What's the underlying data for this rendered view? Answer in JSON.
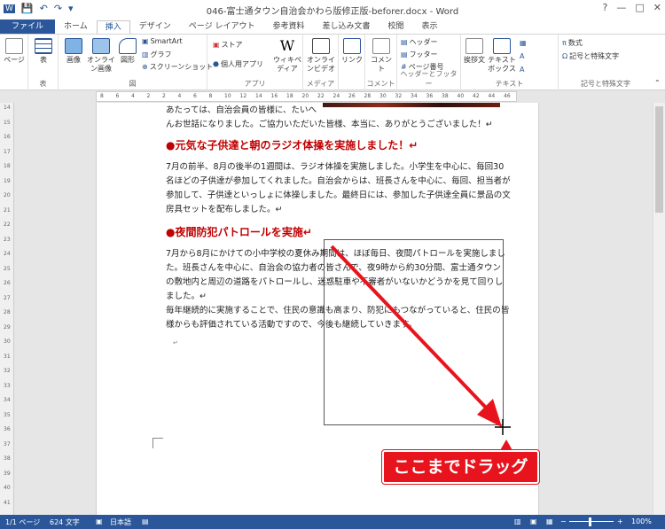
{
  "window": {
    "title": "046-富士通タウン自治会かわら版修正版-beforer.docx - Word",
    "controls": [
      "?",
      "—",
      "□",
      "✕"
    ]
  },
  "tabs": [
    "ファイル",
    "ホーム",
    "挿入",
    "デザイン",
    "ページ レイアウト",
    "参考資料",
    "差し込み文書",
    "校閲",
    "表示"
  ],
  "ribbon": {
    "page_btn": "ページ",
    "table_btn": "表",
    "table_group": "表",
    "picture_btn": "画像",
    "online_picture_btn": "オンライン画像",
    "shapes_btn": "図形",
    "smartart": "SmartArt",
    "graph": "グラフ",
    "screenshot": "スクリーンショット",
    "illustrations_group": "図",
    "store": "ストア",
    "personal_apps": "個人用アプリ",
    "wikipedia": "ウィキペディア",
    "apps_group": "アプリ",
    "online_video": "オンラインビデオ",
    "media_group": "メディア",
    "link_btn": "リンク",
    "comment_btn": "コメント",
    "comment_group": "コメント",
    "header": "ヘッダー",
    "footer": "フッター",
    "page_number": "ページ番号",
    "header_footer_group": "ヘッダーとフッター",
    "greeting_btn": "挨拶文",
    "textbox_btn": "テキストボックス",
    "text_group": "テキスト",
    "equation": "数式",
    "symbol": "記号と特殊文字",
    "symbols_group": "記号と特殊文字"
  },
  "ruler_numbers": [
    "8",
    "6",
    "4",
    "2",
    "2",
    "4",
    "6",
    "8",
    "10",
    "12",
    "14",
    "16",
    "18",
    "20",
    "22",
    "24",
    "26",
    "28",
    "30",
    "32",
    "34",
    "36",
    "38",
    "40",
    "42",
    "44",
    "46"
  ],
  "left_ruler": [
    "14",
    "15",
    "16",
    "17",
    "18",
    "19",
    "20",
    "21",
    "22",
    "23",
    "24",
    "25",
    "26",
    "27",
    "28",
    "29",
    "30",
    "31",
    "32",
    "33",
    "34",
    "35",
    "36",
    "37",
    "38",
    "39",
    "40",
    "41"
  ],
  "document": {
    "lines_top": [
      "あたっては、自治会員の皆様に、たいへ",
      "んお世話になりました。ご協力いただいた皆様、本当に、ありがとうございました！↵"
    ],
    "heading1": "●元気な子供達と朝のラジオ体操を実施しました！↵",
    "para1": [
      "7月の前半、8月の後半の1週間は、ラジオ体操を実施しました。小学生を中心に、毎回30",
      "名ほどの子供達が参加してくれました。自治会からは、班長さんを中心に、毎回、担当者が",
      "参加して、子供達といっしょに体操しました。最終日には、参加した子供達全員に景品の文",
      "房具セットを配布しました。↵"
    ],
    "heading2": "●夜間防犯パトロールを実施↵",
    "para2": [
      "7月から8月にかけての小中学校の夏休み期間は、ほぼ毎日、夜間パトロールを実施しまし",
      "た。班長さんを中心に、自治会の協力者の皆さんで、夜9時から約30分間、富士通タウン",
      "の敷地内と周辺の道路をパトロールし、迷惑駐車や不審者がいないかどうかを見て回りし",
      "ました。↵",
      "毎年継続的に実施することで、住民の意識も高まり、防犯にもつながっていると、住民の皆",
      "様からも評価されている活動ですので、今後も継続していきます。"
    ],
    "para_mark": "↵"
  },
  "callout": {
    "text": "ここまでドラッグ",
    "color": "#e8141d"
  },
  "status": {
    "page": "1/1 ページ",
    "words": "624 文字",
    "language": "日本語",
    "zoom": "100%"
  },
  "colors": {
    "accent": "#2b579a",
    "heading_red": "#c00000"
  }
}
